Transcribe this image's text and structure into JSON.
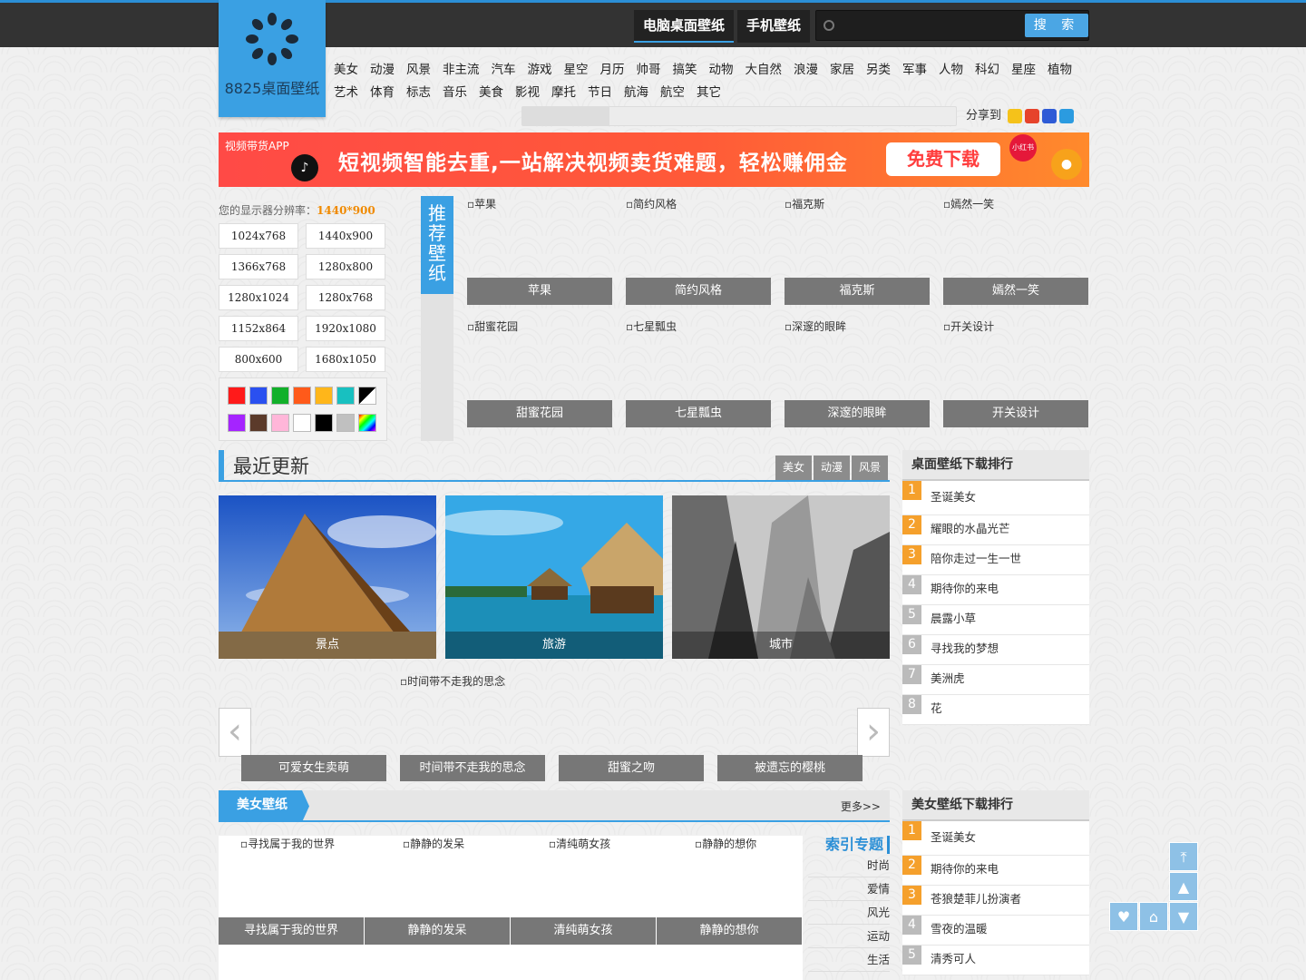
{
  "logo": {
    "name": "8825桌面壁纸"
  },
  "top_tabs": [
    "电脑桌面壁纸",
    "手机壁纸"
  ],
  "search": {
    "placeholder": "",
    "button": "搜 索"
  },
  "nav_row1": [
    "美女",
    "动漫",
    "风景",
    "非主流",
    "汽车",
    "游戏",
    "星空",
    "月历",
    "帅哥",
    "搞笑",
    "动物",
    "大自然",
    "浪漫",
    "家居",
    "另类",
    "军事",
    "人物",
    "科幻",
    "星座",
    "植物"
  ],
  "nav_row2": [
    "艺术",
    "体育",
    "标志",
    "音乐",
    "美食",
    "影视",
    "摩托",
    "节日",
    "航海",
    "航空",
    "其它"
  ],
  "share": {
    "label": "分享到"
  },
  "banner": {
    "tag": "视频带货APP",
    "title": "短视频智能去重,一站解决视频卖货难题，轻松赚佣金",
    "button": "免费下载",
    "xhs": "小红书"
  },
  "resolution": {
    "label": "您的显示器分辨率：",
    "value": "1440*900",
    "options": [
      "1024x768",
      "1440x900",
      "1366x768",
      "1280x800",
      "1280x1024",
      "1280x768",
      "1152x864",
      "1920x1080",
      "800x600",
      "1680x1050"
    ]
  },
  "colors": [
    "#ff1a1a",
    "#2a50f0",
    "#12b02a",
    "#ff5a1a",
    "#ffb61a",
    "#18c0c0",
    "diag",
    "#a524ff",
    "#5b3a2a",
    "#ffb6d9",
    "#ffffff",
    "#000000",
    "#c0c0c0",
    "rainbow"
  ],
  "recommend": {
    "title": "推荐壁纸",
    "items": [
      "苹果",
      "简约风格",
      "福克斯",
      "嫣然一笑",
      "甜蜜花园",
      "七星瓢虫",
      "深邃的眼眸",
      "开关设计"
    ]
  },
  "recent": {
    "title": "最近更新",
    "tabs": [
      "美女",
      "动漫",
      "风景"
    ],
    "photos": [
      "景点",
      "旅游",
      "城市"
    ],
    "slide_alt": "时间带不走我的思念",
    "slides": [
      "可爱女生卖萌",
      "时间带不走我的思念",
      "甜蜜之吻",
      "被遗忘的樱桃"
    ]
  },
  "rank1": {
    "title": "桌面壁纸下载排行",
    "items": [
      "圣诞美女",
      "耀眼的水晶光芒",
      "陪你走过一生一世",
      "期待你的来电",
      "晨露小草",
      "寻找我的梦想",
      "美洲虎",
      "花"
    ]
  },
  "beauty": {
    "title": "美女壁纸",
    "more": "更多>>",
    "items": [
      "寻找属于我的世界",
      "静静的发呆",
      "清纯萌女孩",
      "静静的想你"
    ],
    "index_title": "索引专题",
    "index": [
      "时尚",
      "爱情",
      "风光",
      "运动",
      "生活"
    ]
  },
  "rank2": {
    "title": "美女壁纸下载排行",
    "items": [
      "圣诞美女",
      "期待你的来电",
      "苍狼楚菲儿扮演者",
      "雪夜的温暖",
      "清秀可人"
    ]
  },
  "float_icons": [
    "top-icon",
    "up-icon",
    "heart-icon",
    "home-icon",
    "down-icon"
  ]
}
